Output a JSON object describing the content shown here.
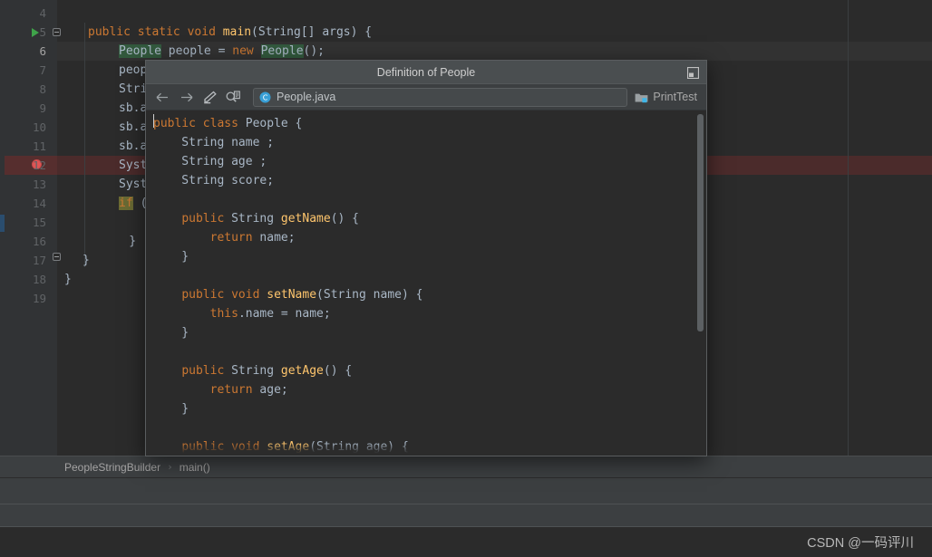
{
  "editor": {
    "name": "java-code-editor",
    "lines": [
      {
        "num": "4",
        "indent": 0,
        "tokens": []
      },
      {
        "num": "5",
        "indent": 0,
        "gutter": {
          "run": true,
          "fold": true
        },
        "tokens": [
          {
            "t": "public ",
            "c": "kw"
          },
          {
            "t": "static ",
            "c": "kw"
          },
          {
            "t": "void ",
            "c": "kw"
          },
          {
            "t": "main",
            "c": "mthb"
          },
          {
            "t": "(String[] args) {",
            "c": "txt"
          }
        ]
      },
      {
        "num": "6",
        "current": true,
        "tokens": [
          {
            "t": "People",
            "c": "txt",
            "hl": "green"
          },
          {
            "t": " people = ",
            "c": "txt"
          },
          {
            "t": "new ",
            "c": "kw"
          },
          {
            "t": "People",
            "c": "txt",
            "hl": "green"
          },
          {
            "t": "();",
            "c": "txt"
          }
        ]
      },
      {
        "num": "7",
        "tokens": [
          {
            "t": "peopl",
            "c": "txt"
          }
        ]
      },
      {
        "num": "8",
        "tokens": [
          {
            "t": "Strin",
            "c": "txt"
          }
        ]
      },
      {
        "num": "9",
        "tokens": [
          {
            "t": "sb.ap",
            "c": "txt"
          }
        ]
      },
      {
        "num": "10",
        "tokens": [
          {
            "t": "sb.ap",
            "c": "txt"
          }
        ]
      },
      {
        "num": "11",
        "tokens": [
          {
            "t": "sb.ap",
            "c": "txt"
          }
        ]
      },
      {
        "num": "12",
        "breakpoint": true,
        "tokens": [
          {
            "t": "Syste",
            "c": "txt"
          }
        ]
      },
      {
        "num": "13",
        "tokens": [
          {
            "t": "Syste",
            "c": "txt"
          }
        ]
      },
      {
        "num": "14",
        "tokens": [
          {
            "t": "if",
            "c": "kw",
            "hl": "olive"
          },
          {
            "t": " (",
            "c": "txt"
          },
          {
            "t": "\"",
            "c": "str",
            "hl": "green"
          }
        ]
      },
      {
        "num": "15",
        "tokens": []
      },
      {
        "num": "16",
        "tokens": [
          {
            "t": "    }",
            "c": "txt"
          }
        ]
      },
      {
        "num": "17",
        "gutter": {
          "fold": true
        },
        "tokens": [
          {
            "t": "}",
            "c": "txt"
          }
        ]
      },
      {
        "num": "18",
        "outdent": true,
        "tokens": [
          {
            "t": "}",
            "c": "txt"
          }
        ]
      },
      {
        "num": "19",
        "tokens": []
      }
    ]
  },
  "breadcrumb": {
    "name": "editor-breadcrumb",
    "items": [
      "PeopleStringBuilder",
      "main()"
    ],
    "separator": "›"
  },
  "popup": {
    "title": "Definition of People",
    "window_button_name": "move-to-editor-icon",
    "toolbar": {
      "back_label": "←",
      "forward_label": "→",
      "edit_label": "edit-source-icon",
      "find_usages_label": "find-usages-icon",
      "file_name": "People.java",
      "file_icon": "java-class-icon",
      "module_name": "PrintTest",
      "module_icon": "module-folder-icon"
    },
    "code_lines": [
      [
        {
          "t": "public ",
          "c": "kw"
        },
        {
          "t": "class ",
          "c": "kw"
        },
        {
          "t": "People {",
          "c": "txt"
        }
      ],
      [
        {
          "t": "    String name ;",
          "c": "txt"
        }
      ],
      [
        {
          "t": "    String age ;",
          "c": "txt"
        }
      ],
      [
        {
          "t": "    String score;",
          "c": "txt"
        }
      ],
      [],
      [
        {
          "t": "    ",
          "c": "txt"
        },
        {
          "t": "public ",
          "c": "kw"
        },
        {
          "t": "String ",
          "c": "txt"
        },
        {
          "t": "getName",
          "c": "mth"
        },
        {
          "t": "() {",
          "c": "txt"
        }
      ],
      [
        {
          "t": "        ",
          "c": "txt"
        },
        {
          "t": "return ",
          "c": "kw"
        },
        {
          "t": "name;",
          "c": "txt"
        }
      ],
      [
        {
          "t": "    }",
          "c": "txt"
        }
      ],
      [],
      [
        {
          "t": "    ",
          "c": "txt"
        },
        {
          "t": "public ",
          "c": "kw"
        },
        {
          "t": "void ",
          "c": "kw"
        },
        {
          "t": "setName",
          "c": "mth"
        },
        {
          "t": "(String name) {",
          "c": "txt"
        }
      ],
      [
        {
          "t": "        ",
          "c": "txt"
        },
        {
          "t": "this",
          "c": "kw"
        },
        {
          "t": ".name = name;",
          "c": "txt"
        }
      ],
      [
        {
          "t": "    }",
          "c": "txt"
        }
      ],
      [],
      [
        {
          "t": "    ",
          "c": "txt"
        },
        {
          "t": "public ",
          "c": "kw"
        },
        {
          "t": "String ",
          "c": "txt"
        },
        {
          "t": "getAge",
          "c": "mth"
        },
        {
          "t": "() {",
          "c": "txt"
        }
      ],
      [
        {
          "t": "        ",
          "c": "txt"
        },
        {
          "t": "return ",
          "c": "kw"
        },
        {
          "t": "age;",
          "c": "txt"
        }
      ],
      [
        {
          "t": "    }",
          "c": "txt"
        }
      ],
      [],
      [
        {
          "t": "    ",
          "c": "txt"
        },
        {
          "t": "public ",
          "c": "kw"
        },
        {
          "t": "void ",
          "c": "kw"
        },
        {
          "t": "setAge",
          "c": "mth"
        },
        {
          "t": "(String age) {",
          "c": "txt"
        }
      ],
      [
        {
          "t": "        ...",
          "c": "txt"
        }
      ]
    ]
  },
  "watermark": {
    "text": "CSDN @一码评川"
  },
  "colors": {
    "editor_bg": "#2b2b2b",
    "gutter_bg": "#313335",
    "panel_bg": "#3c3f41",
    "keyword": "#cc7832",
    "method": "#ffc66d",
    "string": "#6a8759",
    "text": "#a9b7c6",
    "breakpoint": "#e05555",
    "run_green": "#3fa34a",
    "highlight_green": "#32593d",
    "highlight_olive": "#6a6a33",
    "breakpoint_line": "#4b2b2b"
  }
}
